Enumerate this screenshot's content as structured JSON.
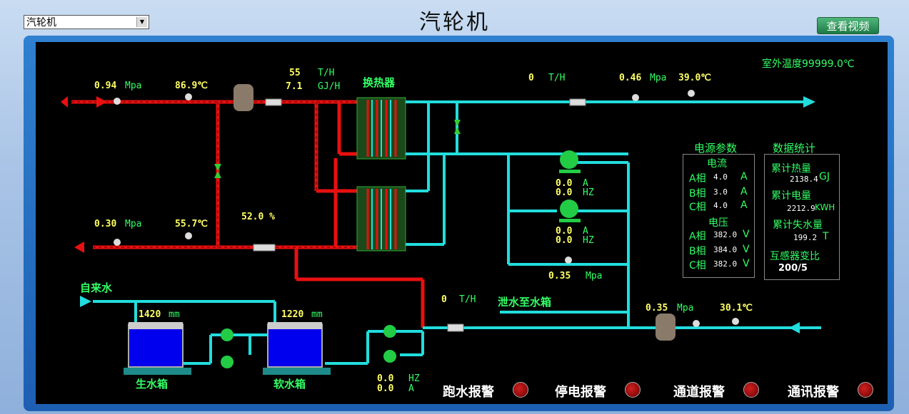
{
  "window": {
    "title": "汽轮机",
    "selector_value": "汽轮机",
    "video_button": "查看视频"
  },
  "readings": {
    "in_pressure": "0.94",
    "in_pressure_unit": "Mpa",
    "in_temp": "86.9℃",
    "flow1_value": "55",
    "flow1_unit": "T/H",
    "heat1_value": "7.1",
    "heat1_unit": "GJ/H",
    "hx_label": "换热器",
    "flow2_value": "0",
    "flow2_unit": "T/H",
    "out_pressure": "0.46",
    "out_pressure_unit": "Mpa",
    "out_temp": "39.0℃",
    "outdoor_temp": "室外温度99999.0℃",
    "ret_pressure": "0.30",
    "ret_pressure_unit": "Mpa",
    "ret_temp": "55.7℃",
    "valve_open": "52.0 %",
    "pump1_a": "0.0",
    "pump1_a_unit": "A",
    "pump1_hz": "0.0",
    "pump1_hz_unit": "HZ",
    "pump2_a": "0.0",
    "pump2_a_unit": "A",
    "pump2_hz": "0.0",
    "pump2_hz_unit": "HZ",
    "bypass_pressure": "0.35",
    "bypass_pressure_unit": "Mpa",
    "tap_water": "自来水",
    "raw_level": "1420",
    "level_unit": "mm",
    "soft_level": "1220",
    "raw_tank": "生水箱",
    "soft_tank": "软水箱",
    "flow3_value": "0",
    "flow3_unit": "T/H",
    "drain_label": "泄水至水箱",
    "ret2_pressure": "0.35",
    "ret2_pressure_unit": "Mpa",
    "ret2_temp": "30.1℃",
    "makeup_hz": "0.0",
    "makeup_hz_unit": "HZ",
    "makeup_a": "0.0",
    "makeup_a_unit": "A"
  },
  "power": {
    "title": "电源参数",
    "current_title": "电流",
    "currents": [
      {
        "phase": "A相",
        "value": "4.0",
        "unit": "A"
      },
      {
        "phase": "B相",
        "value": "3.0",
        "unit": "A"
      },
      {
        "phase": "C相",
        "value": "4.0",
        "unit": "A"
      }
    ],
    "voltage_title": "电压",
    "voltages": [
      {
        "phase": "A相",
        "value": "382.0",
        "unit": "V"
      },
      {
        "phase": "B相",
        "value": "384.0",
        "unit": "V"
      },
      {
        "phase": "C相",
        "value": "382.0",
        "unit": "V"
      }
    ]
  },
  "stats": {
    "title": "数据统计",
    "heat_label": "累计热量",
    "heat_value": "2138.4",
    "heat_unit": "GJ",
    "elec_label": "累计电量",
    "elec_value": "2212.9",
    "elec_unit": "KWH",
    "loss_label": "累计失水量",
    "loss_value": "199.2",
    "loss_unit": "T",
    "ct_label": "互感器变比",
    "ct_value": "200/5"
  },
  "alarms": [
    {
      "label": "跑水报警",
      "color": "#8a0000"
    },
    {
      "label": "停电报警",
      "color": "#8a0000"
    },
    {
      "label": "通道报警",
      "color": "#8a0000"
    },
    {
      "label": "通讯报警",
      "color": "#8a0000"
    }
  ],
  "colors": {
    "hot": "#e81010",
    "cold": "#22dddd",
    "valve": "#33cc33",
    "label_yellow": "#ffff66",
    "label_green": "#33ff66"
  }
}
